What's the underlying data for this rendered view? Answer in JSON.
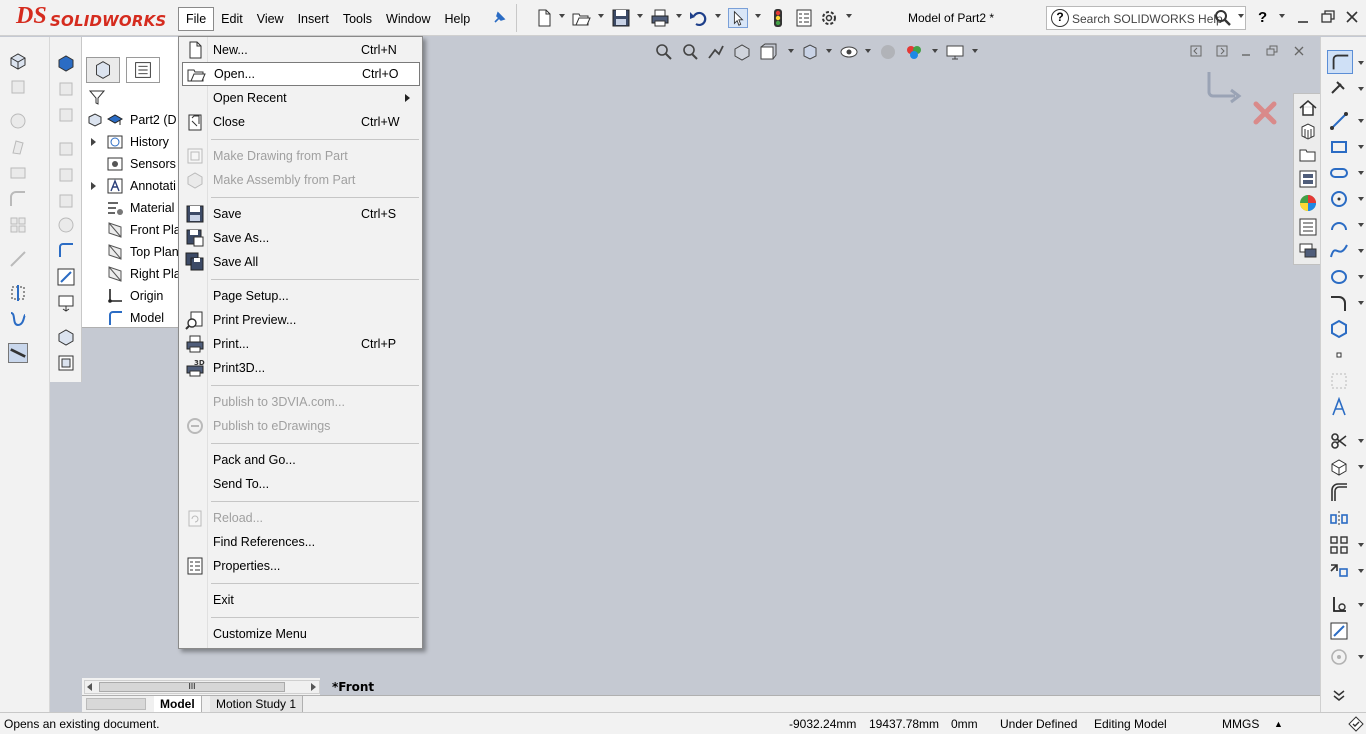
{
  "app": {
    "brand_prefix": "DS",
    "brand_name": "SOLIDWORKS",
    "document_title": "Model of Part2 *",
    "search_placeholder": "Search SOLIDWORKS Help",
    "help_label": "?"
  },
  "menubar": [
    {
      "label": "File"
    },
    {
      "label": "Edit"
    },
    {
      "label": "View"
    },
    {
      "label": "Insert"
    },
    {
      "label": "Tools"
    },
    {
      "label": "Window"
    },
    {
      "label": "Help"
    }
  ],
  "file_menu": {
    "items": [
      {
        "label": "New...",
        "shortcut": "Ctrl+N",
        "icon": "new-document-icon"
      },
      {
        "label": "Open...",
        "shortcut": "Ctrl+O",
        "icon": "open-folder-icon",
        "highlighted": true
      },
      {
        "label": "Open Recent",
        "shortcut": "",
        "icon": "",
        "submenu": true
      },
      {
        "label": "Close",
        "shortcut": "Ctrl+W",
        "icon": "close-document-icon"
      },
      {
        "label": "Make Drawing from Part",
        "shortcut": "",
        "icon": "make-drawing-icon",
        "disabled": true
      },
      {
        "label": "Make Assembly from Part",
        "shortcut": "",
        "icon": "make-assembly-icon",
        "disabled": true
      },
      {
        "label": "Save",
        "shortcut": "Ctrl+S",
        "icon": "save-icon"
      },
      {
        "label": "Save As...",
        "shortcut": "",
        "icon": "save-as-icon"
      },
      {
        "label": "Save All",
        "shortcut": "",
        "icon": "save-all-icon"
      },
      {
        "label": "Page Setup...",
        "shortcut": "",
        "icon": ""
      },
      {
        "label": "Print Preview...",
        "shortcut": "",
        "icon": "print-preview-icon"
      },
      {
        "label": "Print...",
        "shortcut": "Ctrl+P",
        "icon": "print-icon"
      },
      {
        "label": "Print3D...",
        "shortcut": "",
        "icon": "print3d-icon"
      },
      {
        "label": "Publish to 3DVIA.com...",
        "shortcut": "",
        "icon": "",
        "disabled": true
      },
      {
        "label": "Publish to eDrawings",
        "shortcut": "",
        "icon": "edrawings-icon",
        "disabled": true
      },
      {
        "label": "Pack and Go...",
        "shortcut": "",
        "icon": ""
      },
      {
        "label": "Send To...",
        "shortcut": "",
        "icon": ""
      },
      {
        "label": "Reload...",
        "shortcut": "",
        "icon": "reload-icon",
        "disabled": true
      },
      {
        "label": "Find References...",
        "shortcut": "",
        "icon": ""
      },
      {
        "label": "Properties...",
        "shortcut": "",
        "icon": "properties-icon"
      },
      {
        "label": "Exit",
        "shortcut": "",
        "icon": ""
      },
      {
        "label": "Customize Menu",
        "shortcut": "",
        "icon": ""
      }
    ]
  },
  "feature_tree": {
    "root": "Part2  (D",
    "items": [
      {
        "label": "History",
        "icon": "history-icon",
        "expandable": true
      },
      {
        "label": "Sensors",
        "icon": "sensors-icon",
        "expandable": false
      },
      {
        "label": "Annotati",
        "icon": "annotations-icon",
        "expandable": true
      },
      {
        "label": "Material",
        "icon": "material-icon",
        "expandable": false
      },
      {
        "label": "Front Pla",
        "icon": "plane-icon",
        "expandable": false
      },
      {
        "label": "Top Plan",
        "icon": "plane-icon",
        "expandable": false
      },
      {
        "label": "Right Pla",
        "icon": "plane-icon",
        "expandable": false
      },
      {
        "label": "Origin",
        "icon": "origin-icon",
        "expandable": false
      },
      {
        "label": "Model",
        "icon": "sketch-icon",
        "expandable": false
      }
    ]
  },
  "graphics": {
    "view_label": "*Front"
  },
  "bottom_tabs": [
    {
      "label": "Model",
      "active": true
    },
    {
      "label": "Motion Study 1",
      "active": false
    }
  ],
  "scroll_label": "III",
  "status": {
    "message": "Opens an existing document.",
    "x_coord": "-9032.24mm",
    "y_coord": "19437.78mm",
    "z_coord": "0mm",
    "sketch_state": "Under Defined",
    "mode": "Editing Model",
    "units": "MMGS",
    "units_arrow": "▲"
  },
  "colors": {
    "brand_red": "#d52b1e",
    "graphics_bg": "#c5c9d2",
    "menu_bg": "#f2f2f2"
  }
}
